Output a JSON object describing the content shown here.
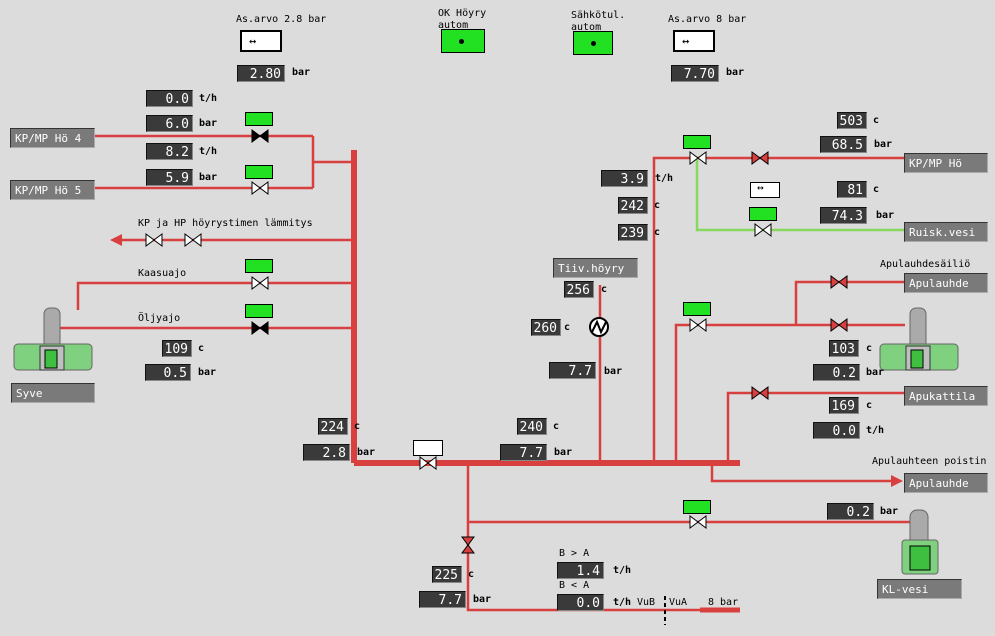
{
  "setpoints": {
    "left": {
      "label": "As.arvo 2.8 bar",
      "value": "2.80",
      "unit": "bar"
    },
    "right": {
      "label": "As.arvo 8 bar",
      "value": "7.70",
      "unit": "bar"
    },
    "ok_steam_label": "OK Höyry\nautom",
    "power_label": "Sähkötul.\nautom"
  },
  "left_lines": {
    "flow1": "0.0",
    "flow1_unit": "t/h",
    "press1": "6.0",
    "press1_unit": "bar",
    "flow2": "8.2",
    "flow2_unit": "t/h",
    "press2": "5.9",
    "press2_unit": "bar",
    "tag_hp4": "KP/MP Hö 4",
    "tag_hp5": "KP/MP Hö 5",
    "heating_label": "KP ja HP höyrystimen lämmitys",
    "gas_label": "Kaasuajo",
    "oil_label": "Öljyajo",
    "syve_temp": "109",
    "syve_temp_unit": "c",
    "syve_press": "0.5",
    "syve_press_unit": "bar",
    "tag_syve": "Syve"
  },
  "main_header": {
    "temp": "224",
    "temp_unit": "c",
    "press": "2.8",
    "press_unit": "bar",
    "temp2": "240",
    "temp2_unit": "c",
    "press2": "7.7",
    "press2_unit": "bar"
  },
  "condensate": {
    "tag": "Tiiv.höyry",
    "temp1": "256",
    "temp1_unit": "c",
    "temp2": "260",
    "temp2_unit": "c",
    "press": "7.7",
    "press_unit": "bar"
  },
  "center_readings": {
    "flow": "3.9",
    "flow_unit": "t/h",
    "temp1": "242",
    "temp1_unit": "c",
    "temp2": "239",
    "temp2_unit": "c"
  },
  "right_lines": {
    "temp1": "503",
    "temp1_unit": "c",
    "press1": "68.5",
    "press1_unit": "bar",
    "tag_hp": "KP/MP Hö",
    "temp2": "81",
    "temp2_unit": "c",
    "press2": "74.3",
    "press2_unit": "bar",
    "tag_water": "Ruisk.vesi",
    "aux_tank_label": "Apulauhdesäiliö",
    "tag_aux1": "Apulauhde",
    "aux_temp": "103",
    "aux_temp_unit": "c",
    "aux_press": "0.2",
    "aux_press_unit": "bar",
    "tag_aux_boiler": "Apukattila",
    "boiler_temp": "169",
    "boiler_temp_unit": "c",
    "boiler_flow": "0.0",
    "boiler_flow_unit": "t/h",
    "aux_remover_label": "Apulauhteen poistin",
    "tag_aux2": "Apulauhde",
    "kl_press": "0.2",
    "kl_press_unit": "bar",
    "tag_kl": "KL-vesi"
  },
  "bottom": {
    "temp": "225",
    "temp_unit": "c",
    "press": "7.7",
    "press_unit": "bar",
    "ba_label": "B > A",
    "ba_value": "1.4",
    "ba_unit": "t/h",
    "ab_label": "B < A",
    "ab_value": "0.0",
    "ab_unit": "t/h",
    "vub": "VuB",
    "vua": "VuA",
    "line_label": "8 bar"
  },
  "colors": {
    "pipe": "#d84040",
    "pipe_green": "#88d860",
    "background": "#dcdcdc",
    "indicator": "#22e022"
  }
}
